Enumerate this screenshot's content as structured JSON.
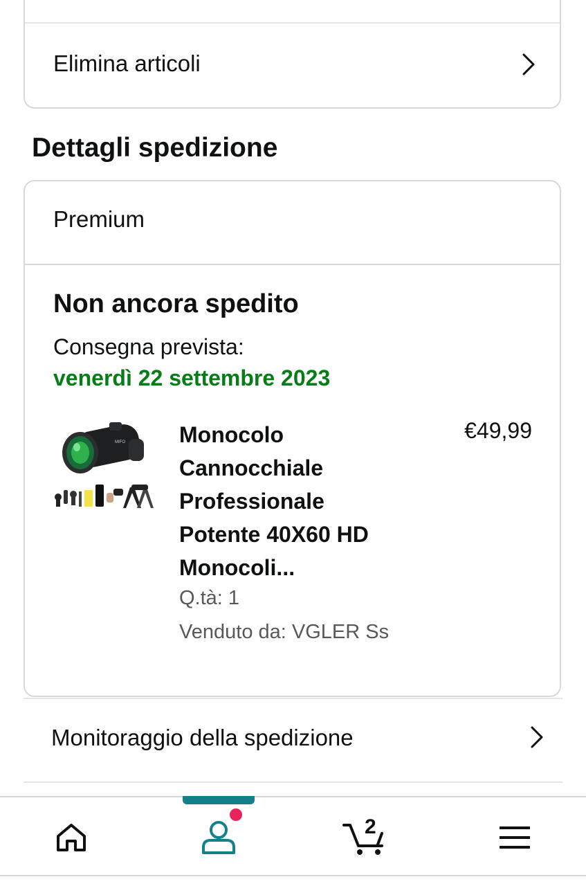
{
  "actions": {
    "delete_items_label": "Elimina articoli"
  },
  "shipping": {
    "section_title": "Dettagli spedizione",
    "program": "Premium",
    "status": "Non ancora spedito",
    "delivery_label": "Consegna prevista:",
    "delivery_date": "venerdì 22 settembre 2023",
    "accent_color": "#067d16",
    "item": {
      "title": "Monocolo Cannocchiale Professionale Potente 40X60 HD Monocoli...",
      "price": "€49,99",
      "quantity": "Q.tà: 1",
      "seller": "Venduto da: VGLER Ss",
      "image_icon": "monocular-product-image"
    },
    "tracking_label": "Monitoraggio della spedizione"
  },
  "nav": {
    "items": [
      {
        "name": "home",
        "icon": "home-icon"
      },
      {
        "name": "account",
        "icon": "user-icon",
        "active": true
      },
      {
        "name": "cart",
        "icon": "cart-icon",
        "count": "2"
      },
      {
        "name": "menu",
        "icon": "menu-icon"
      }
    ],
    "active_color": "#13808a",
    "notification_color": "#e6245b"
  }
}
